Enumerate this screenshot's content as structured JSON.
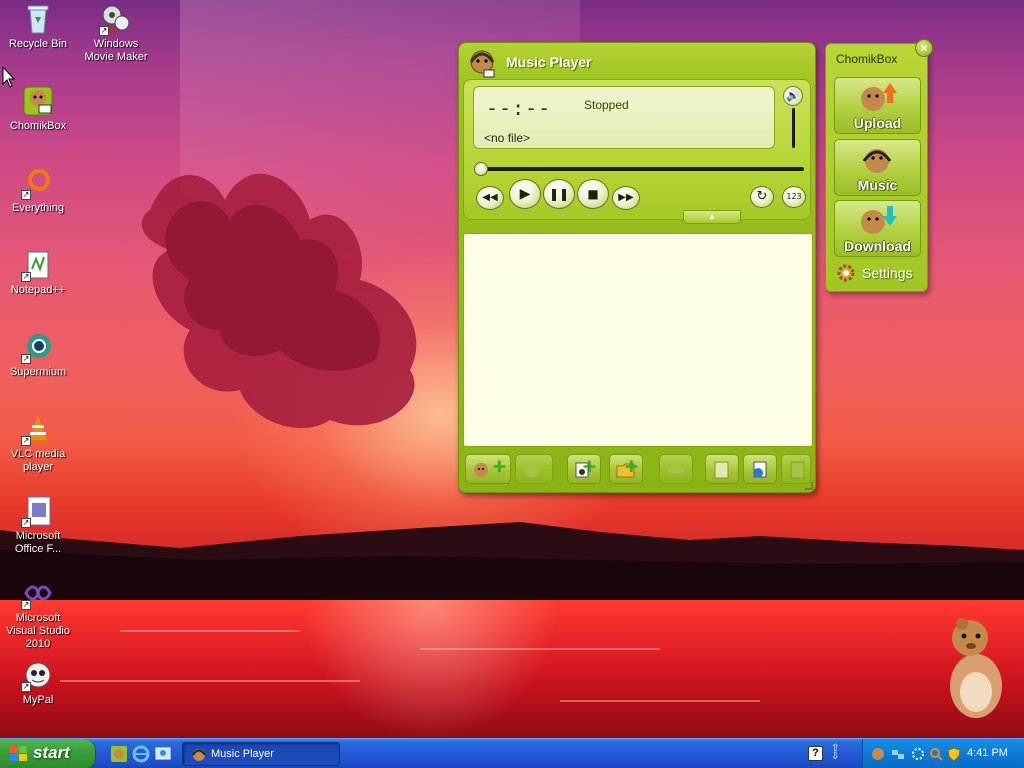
{
  "desktop": {
    "icons": [
      {
        "label": "Recycle Bin",
        "icon": "recycle-bin-icon"
      },
      {
        "label": "Windows Movie Maker",
        "icon": "movie-maker-icon"
      },
      {
        "label": "ChomikBox",
        "icon": "chomikbox-icon"
      },
      {
        "label": "Everything",
        "icon": "everything-search-icon"
      },
      {
        "label": "Notepad++",
        "icon": "notepad-plus-plus-icon"
      },
      {
        "label": "Supermium",
        "icon": "supermium-browser-icon"
      },
      {
        "label": "VLC media player",
        "icon": "vlc-cone-icon"
      },
      {
        "label": "Microsoft Office F...",
        "icon": "office-document-icon"
      },
      {
        "label": "Microsoft Visual Studio 2010",
        "icon": "visual-studio-icon"
      },
      {
        "label": "MyPal",
        "icon": "mypal-browser-icon"
      }
    ]
  },
  "player": {
    "title": "Music Player",
    "time": "--:--",
    "status": "Stopped",
    "file": "<no file>",
    "seek_progress": 0,
    "volume_level": 1.0,
    "controls": [
      "rewind-icon",
      "play-icon",
      "pause-icon",
      "stop-icon",
      "fast-forward-icon"
    ],
    "toggles": [
      "repeat-icon",
      "track-number-icon"
    ],
    "toolbar": [
      "add-file-icon",
      "add-disabled-icon",
      "add-playlist-icon",
      "add-folder-icon",
      "remove-disabled-icon",
      "save-icon",
      "open-list-icon",
      "export-disabled-icon"
    ]
  },
  "chomikbox": {
    "title": "ChomikBox",
    "upload_label": "Upload",
    "music_label": "Music",
    "download_label": "Download",
    "settings_label": "Settings"
  },
  "taskbar": {
    "start_label": "start",
    "quick_launch": [
      "chomikbox-icon",
      "internet-explorer-icon",
      "desktop-icon"
    ],
    "task_label": "Music Player",
    "clock": "4:41 PM",
    "tray_icons": [
      "chomikbox-tray-icon",
      "network-icon",
      "search-tray-icon",
      "security-shield-icon"
    ],
    "colors": {
      "taskbar": "#2358d6",
      "start": "#3a9e3a",
      "tray": "#0c7ad8",
      "player": "#9cc21e"
    }
  }
}
